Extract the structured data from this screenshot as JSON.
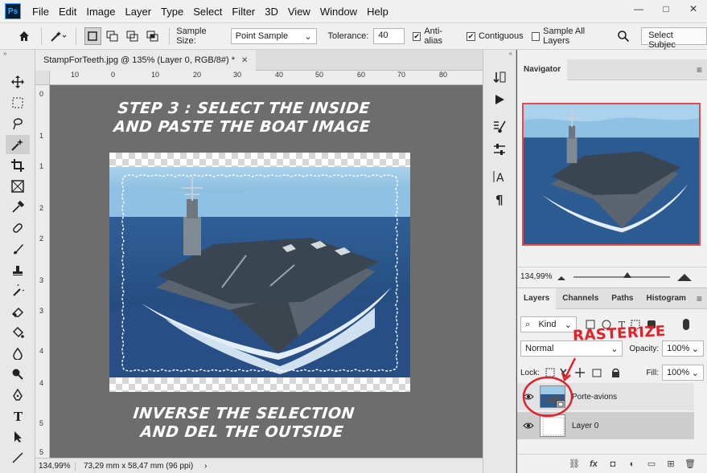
{
  "app": {
    "logo_text": "Ps"
  },
  "menu": [
    "File",
    "Edit",
    "Image",
    "Layer",
    "Type",
    "Select",
    "Filter",
    "3D",
    "View",
    "Window",
    "Help"
  ],
  "window_controls": {
    "minimize": "—",
    "maximize": "□",
    "close": "✕"
  },
  "options": {
    "sample_size_label": "Sample Size:",
    "sample_size_value": "Point Sample",
    "tolerance_label": "Tolerance:",
    "tolerance_value": "40",
    "anti_alias_label": "Anti-alias",
    "anti_alias_checked": true,
    "contiguous_label": "Contiguous",
    "contiguous_checked": true,
    "sample_all_layers_label": "Sample All Layers",
    "sample_all_layers_checked": false,
    "select_subject_label": "Select Subjec"
  },
  "document": {
    "tab_title": "StampForTeeth.jpg @ 135% (Layer 0, RGB/8#) *",
    "close": "✕",
    "ruler_h_ticks": [
      "10",
      "0",
      "10",
      "20",
      "30",
      "40",
      "50",
      "60",
      "70",
      "80"
    ],
    "ruler_v_ticks": [
      "0",
      "1",
      "1",
      "2",
      "2",
      "3",
      "3",
      "4",
      "4",
      "5",
      "5"
    ],
    "annotation_top": [
      "STEP 3 : SELECT THE INSIDE",
      "AND PASTE THE BOAT IMAGE"
    ],
    "annotation_bottom": [
      "INVERSE THE SELECTION",
      "AND DEL THE OUTSIDE"
    ]
  },
  "status": {
    "zoom": "134,99%",
    "doc_info": "73,29 mm x 58,47 mm (96 ppi)",
    "arrow": "›"
  },
  "navigator": {
    "tab": "Navigator",
    "zoom": "134,99%"
  },
  "layers_panel": {
    "tabs": [
      "Layers",
      "Channels",
      "Paths",
      "Histogram"
    ],
    "kind_label": "Kind",
    "blend_mode": "Normal",
    "opacity_label": "Opacity:",
    "opacity_value": "100%",
    "lock_label": "Lock:",
    "fill_label": "Fill:",
    "fill_value": "100%",
    "layers": [
      {
        "name": "Porte-avions",
        "visible": true
      },
      {
        "name": "Layer 0",
        "visible": true
      }
    ],
    "footer_icons": [
      "link-icon",
      "fx-icon",
      "mask-icon",
      "adjustment-icon",
      "group-icon",
      "new-layer-icon",
      "trash-icon"
    ],
    "footer_labels": [
      "⛓",
      "fx",
      "◘",
      "◐",
      "▭",
      "⊞",
      "🗑"
    ]
  },
  "annotation": {
    "rasterize": "RASTERIZE",
    "color": "#e0232a"
  }
}
